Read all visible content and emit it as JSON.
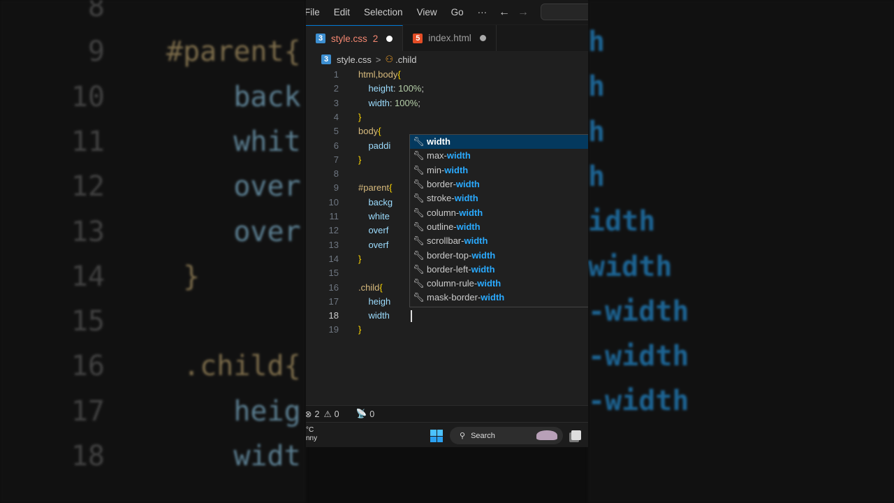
{
  "menu": {
    "items": [
      "File",
      "Edit",
      "Selection",
      "View",
      "Go",
      "···"
    ],
    "back": "←",
    "forward": "→"
  },
  "tabs": [
    {
      "label": "style.css",
      "badge": "2",
      "icon": "3"
    },
    {
      "label": "index.html",
      "icon": "5"
    }
  ],
  "breadcrumb": {
    "file": "style.css",
    "separator": ">",
    "symbol": ".child"
  },
  "code": [
    {
      "n": "1",
      "parts": [
        [
          "sel",
          "html,body"
        ],
        [
          "br",
          "{"
        ]
      ]
    },
    {
      "n": "2",
      "parts": [
        [
          "pl",
          "    "
        ],
        [
          "prop",
          "height"
        ],
        [
          "pl",
          ": "
        ],
        [
          "num",
          "100%"
        ],
        [
          "pl",
          ";"
        ]
      ]
    },
    {
      "n": "3",
      "parts": [
        [
          "pl",
          "    "
        ],
        [
          "prop",
          "width"
        ],
        [
          "pl",
          ": "
        ],
        [
          "num",
          "100%"
        ],
        [
          "pl",
          ";"
        ]
      ]
    },
    {
      "n": "4",
      "parts": [
        [
          "br",
          "}"
        ]
      ]
    },
    {
      "n": "5",
      "parts": [
        [
          "sel",
          "body"
        ],
        [
          "br",
          "{"
        ]
      ]
    },
    {
      "n": "6",
      "parts": [
        [
          "pl",
          "    "
        ],
        [
          "prop",
          "paddi"
        ]
      ]
    },
    {
      "n": "7",
      "parts": [
        [
          "br",
          "}"
        ]
      ]
    },
    {
      "n": "8",
      "parts": []
    },
    {
      "n": "9",
      "parts": [
        [
          "sel",
          "#parent"
        ],
        [
          "br",
          "{"
        ]
      ]
    },
    {
      "n": "10",
      "parts": [
        [
          "pl",
          "    "
        ],
        [
          "prop",
          "backg"
        ]
      ]
    },
    {
      "n": "11",
      "parts": [
        [
          "pl",
          "    "
        ],
        [
          "prop",
          "white"
        ]
      ]
    },
    {
      "n": "12",
      "parts": [
        [
          "pl",
          "    "
        ],
        [
          "prop",
          "overf"
        ]
      ]
    },
    {
      "n": "13",
      "parts": [
        [
          "pl",
          "    "
        ],
        [
          "prop",
          "overf"
        ]
      ]
    },
    {
      "n": "14",
      "parts": [
        [
          "br",
          "}"
        ]
      ]
    },
    {
      "n": "15",
      "parts": []
    },
    {
      "n": "16",
      "parts": [
        [
          "sel",
          ".child"
        ],
        [
          "br",
          "{"
        ]
      ]
    },
    {
      "n": "17",
      "parts": [
        [
          "pl",
          "    "
        ],
        [
          "prop",
          "heigh"
        ]
      ]
    },
    {
      "n": "18",
      "parts": [
        [
          "pl",
          "    "
        ],
        [
          "prop",
          "width"
        ]
      ]
    },
    {
      "n": "19",
      "parts": [
        [
          "br",
          "}"
        ]
      ]
    }
  ],
  "current_line": "18",
  "suggestions": [
    [
      "",
      "width"
    ],
    [
      "max-",
      "width"
    ],
    [
      "min-",
      "width"
    ],
    [
      "border-",
      "width"
    ],
    [
      "stroke-",
      "width"
    ],
    [
      "column-",
      "width"
    ],
    [
      "outline-",
      "width"
    ],
    [
      "scrollbar-",
      "width"
    ],
    [
      "border-top-",
      "width"
    ],
    [
      "border-left-",
      "width"
    ],
    [
      "column-rule-",
      "width"
    ],
    [
      "mask-border-",
      "width"
    ]
  ],
  "status": {
    "errors": "2",
    "warnings": "0",
    "ports": "0"
  },
  "taskbar": {
    "weather_temp": "°C",
    "weather_desc": "nny",
    "search": "Search"
  },
  "background_left": [
    [
      "8",
      ""
    ],
    [
      "9",
      "#parent{"
    ],
    [
      "10",
      "    back"
    ],
    [
      "11",
      "    whit"
    ],
    [
      "12",
      "    over"
    ],
    [
      "13",
      "    over"
    ],
    [
      "14",
      " }"
    ],
    [
      "15",
      ""
    ],
    [
      "16",
      " .child{"
    ],
    [
      "17",
      "    heig"
    ],
    [
      "18",
      "    widt"
    ]
  ],
  "background_right": [
    "h",
    "h",
    "h",
    "h",
    "idth",
    "width",
    "-width",
    "-width",
    "-width"
  ],
  "colors": {
    "accent": "#0078d4",
    "selection": "#04395e",
    "match": "#2aaaff",
    "error_tab": "#f48771"
  }
}
